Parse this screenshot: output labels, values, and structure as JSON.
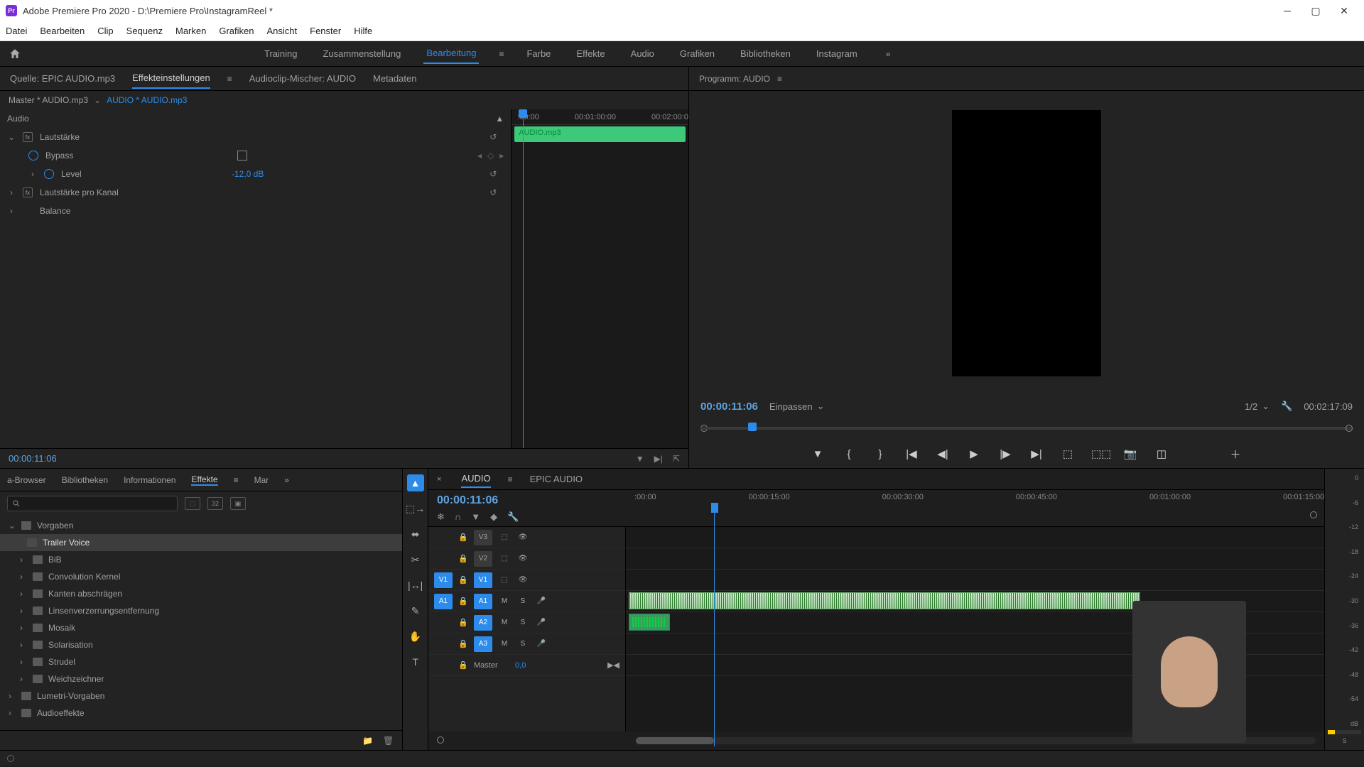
{
  "app": {
    "title": "Adobe Premiere Pro 2020 - D:\\Premiere Pro\\InstagramReel *",
    "logo_text": "Pr"
  },
  "menu": [
    "Datei",
    "Bearbeiten",
    "Clip",
    "Sequenz",
    "Marken",
    "Grafiken",
    "Ansicht",
    "Fenster",
    "Hilfe"
  ],
  "workspaces": {
    "items": [
      "Training",
      "Zusammenstellung",
      "Bearbeitung",
      "Farbe",
      "Effekte",
      "Audio",
      "Grafiken",
      "Bibliotheken",
      "Instagram"
    ],
    "active_index": 2
  },
  "source_tabs": {
    "items": [
      "Quelle: EPIC AUDIO.mp3",
      "Effekteinstellungen",
      "Audioclip-Mischer: AUDIO",
      "Metadaten"
    ],
    "active_index": 1
  },
  "effect_controls": {
    "master": "Master * AUDIO.mp3",
    "clip": "AUDIO * AUDIO.mp3",
    "section": "Audio",
    "volume_label": "Lautstärke",
    "bypass_label": "Bypass",
    "level_label": "Level",
    "level_value": "-12,0 dB",
    "channel_label": "Lautstärke pro Kanal",
    "balance_label": "Balance",
    "timecode": "00:00:11:06",
    "mini_ruler": [
      ":00:00",
      "00:01:00:00",
      "00:02:00:0"
    ],
    "mini_clip": "AUDIO.mp3"
  },
  "program": {
    "tab": "Programm: AUDIO",
    "timecode": "00:00:11:06",
    "fit": "Einpassen",
    "res": "1/2",
    "duration": "00:02:17:09"
  },
  "effects_panel": {
    "tabs": [
      "a-Browser",
      "Bibliotheken",
      "Informationen",
      "Effekte",
      "Mar"
    ],
    "active_index": 3,
    "tree": [
      {
        "label": "Vorgaben",
        "level": 0,
        "expanded": true
      },
      {
        "label": "Trailer Voice",
        "level": 1,
        "selected": true
      },
      {
        "label": "BiB",
        "level": 1
      },
      {
        "label": "Convolution Kernel",
        "level": 1
      },
      {
        "label": "Kanten abschrägen",
        "level": 1
      },
      {
        "label": "Linsenverzerrungsentfernung",
        "level": 1
      },
      {
        "label": "Mosaik",
        "level": 1
      },
      {
        "label": "Solarisation",
        "level": 1
      },
      {
        "label": "Strudel",
        "level": 1
      },
      {
        "label": "Weichzeichner",
        "level": 1
      },
      {
        "label": "Lumetri-Vorgaben",
        "level": 0
      },
      {
        "label": "Audioeffekte",
        "level": 0
      }
    ]
  },
  "timeline": {
    "tabs": [
      "AUDIO",
      "EPIC AUDIO"
    ],
    "active_index": 0,
    "timecode": "00:00:11:06",
    "ruler": [
      ":00:00",
      "00:00:15:00",
      "00:00:30:00",
      "00:00:45:00",
      "00:01:00:00",
      "00:01:15:00"
    ],
    "tracks": {
      "video": [
        "V3",
        "V2",
        "V1"
      ],
      "audio": [
        "A1",
        "A2",
        "A3"
      ],
      "master": "Master",
      "master_val": "0,0",
      "M": "M",
      "S": "S"
    }
  },
  "meter": {
    "scale": [
      "0",
      "-6",
      "-12",
      "-18",
      "-24",
      "-30",
      "-36",
      "-42",
      "-48",
      "-54",
      "dB"
    ],
    "solo": "S"
  }
}
